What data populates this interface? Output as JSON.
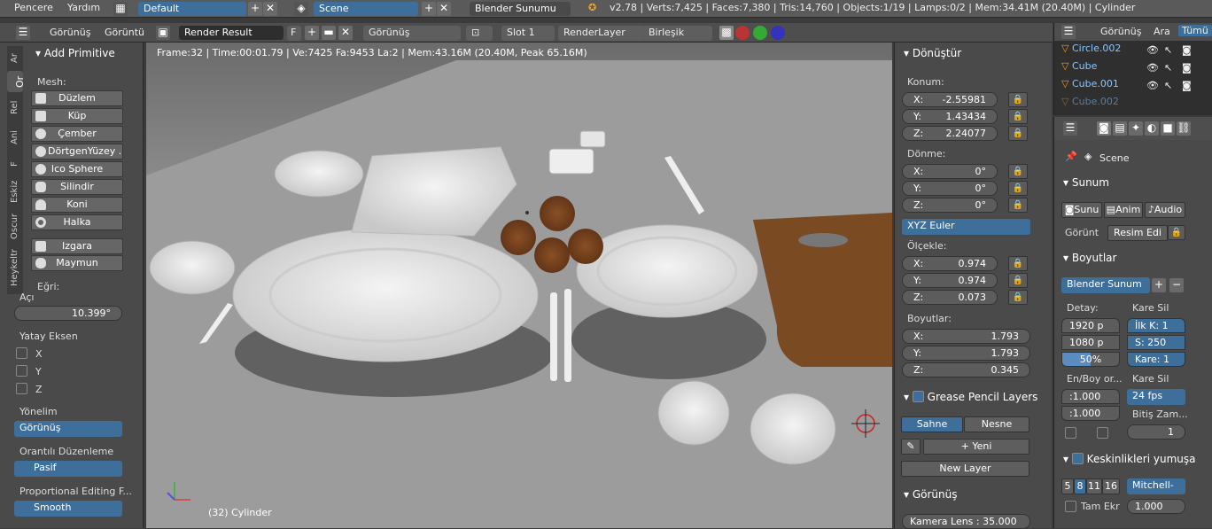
{
  "topbar": {
    "menu": [
      "Pencere",
      "Yardım"
    ],
    "layout": "Default",
    "scene": "Scene",
    "engine": "Blender Sunumu",
    "stats": "v2.78 | Verts:7,425 | Faces:7,380 | Tris:14,760 | Objects:1/19 | Lamps:0/2 | Mem:34.41M (20.40M) | Cylinder"
  },
  "header": {
    "view": "Görünüş",
    "image": "Görüntü",
    "render_result": "Render Result",
    "f_label": "F",
    "display": "Görünüş",
    "slot": "Slot 1",
    "render_layer": "RenderLayer",
    "combined": "Birleşik"
  },
  "left_tabs": [
    "Ar",
    "Or",
    "Rel",
    "Ani",
    "F",
    "Eskiz",
    "Oscur",
    "Heykeltr"
  ],
  "add_primitive": {
    "title": "Add Primitive",
    "mesh_label": "Mesh:",
    "items": [
      "Düzlem",
      "Küp",
      "Çember",
      "DörtgenYüzey ...",
      "Ico Sphere",
      "Silindir",
      "Koni",
      "Halka"
    ],
    "grid": "Izgara",
    "monkey": "Maymun",
    "curve_label": "Eğri:"
  },
  "operator": {
    "angle_label": "Açı",
    "angle_value": "10.399°",
    "axis_label": "Yatay Eksen",
    "axes": [
      "X",
      "Y",
      "Z"
    ],
    "orientation_label": "Yönelim",
    "orientation_value": "Görünüş",
    "prop_edit_label": "Orantılı Düzenleme",
    "prop_edit_value": "Pasif",
    "falloff_label": "Proportional Editing F...",
    "falloff_value": "Smooth"
  },
  "viewport": {
    "info": "Frame:32 | Time:00:01.79 | Ve:7425 Fa:9453 La:2 | Mem:43.16M (20.40M, Peak 65.16M)",
    "footer": "(32) Cylinder"
  },
  "transform": {
    "title": "Dönüştür",
    "location_label": "Konum:",
    "location": [
      {
        "axis": "X:",
        "value": "-2.55981"
      },
      {
        "axis": "Y:",
        "value": "1.43434"
      },
      {
        "axis": "Z:",
        "value": "2.24077"
      }
    ],
    "rotation_label": "Dönme:",
    "rotation": [
      {
        "axis": "X:",
        "value": "0°"
      },
      {
        "axis": "Y:",
        "value": "0°"
      },
      {
        "axis": "Z:",
        "value": "0°"
      }
    ],
    "rotation_mode": "XYZ Euler",
    "scale_label": "Ölçekle:",
    "scale": [
      {
        "axis": "X:",
        "value": "0.974"
      },
      {
        "axis": "Y:",
        "value": "0.974"
      },
      {
        "axis": "Z:",
        "value": "0.073"
      }
    ],
    "dimensions_label": "Boyutlar:",
    "dimensions": [
      {
        "axis": "X:",
        "value": "1.793"
      },
      {
        "axis": "Y:",
        "value": "1.793"
      },
      {
        "axis": "Z:",
        "value": "0.345"
      }
    ]
  },
  "grease_pencil": {
    "title": "Grease Pencil Layers",
    "tabs": [
      "Sahne",
      "Nesne"
    ],
    "new": "Yeni",
    "new_layer": "New Layer"
  },
  "view_panel": {
    "title": "Görünüş",
    "lens": "Kamera Lens : 35.000"
  },
  "outliner": {
    "header": [
      "Görünüş",
      "Ara",
      "Tümü"
    ],
    "rows": [
      "Circle.002",
      "Cube",
      "Cube.001",
      "Cube.002"
    ]
  },
  "properties": {
    "scene": "Scene",
    "render_title": "Sunum",
    "render_tabs": [
      "Sunu",
      "Anim",
      "Audio"
    ],
    "display_label": "Görünt",
    "display_value": "Resim Edi",
    "dimensions_title": "Boyutlar",
    "preset": "Blender Sunum",
    "resolution_label": "Detay:",
    "res_x": "1920 p",
    "res_y": "1080 p",
    "res_pct": "50%",
    "res_pct_value": 0.5,
    "frame_label": "Kare Sil",
    "frame_start": "İlk K: 1",
    "frame_end": "S: 250",
    "frame_step": "Kare: 1",
    "aspect_label": "En/Boy or...",
    "aspect_x": ":1.000",
    "aspect_y": ":1.000",
    "fps_label": "Kare Sil",
    "fps": "24 fps",
    "end_label": "Bitiş Zam...",
    "end_value": "1",
    "aa_title": "Keskinlikleri yumuşa",
    "aa_samples": [
      "5",
      "8",
      "11",
      "16"
    ],
    "aa_filter": "Mitchell-",
    "full_label": "Tam Ekr",
    "full_value": "1.000"
  }
}
